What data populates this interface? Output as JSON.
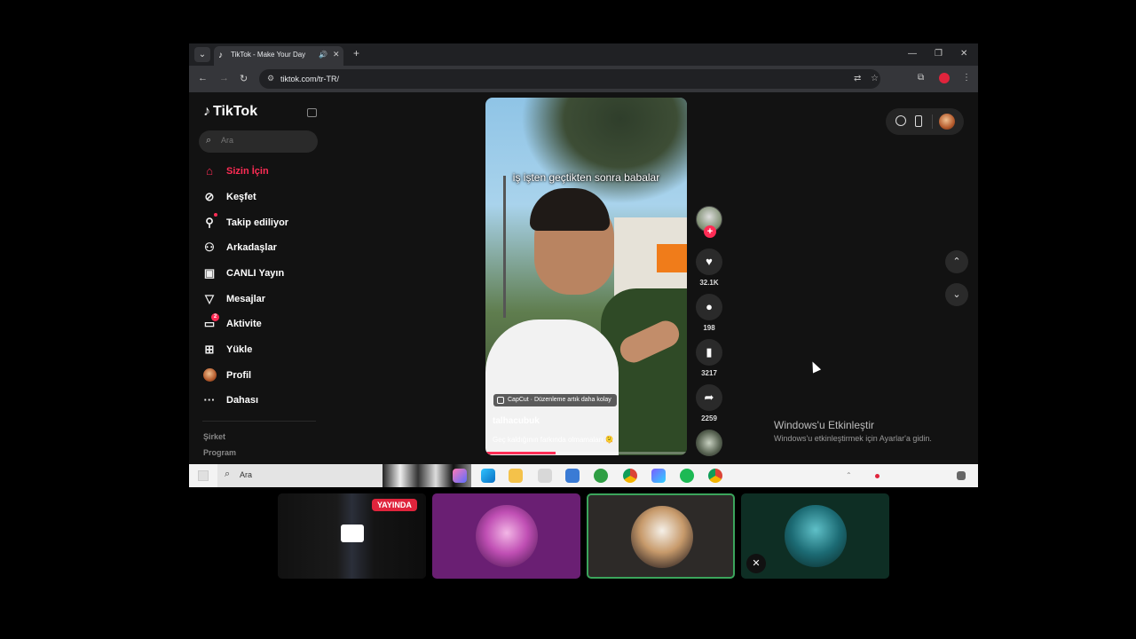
{
  "browser": {
    "tab_title": "TikTok - Make Your Day",
    "url": "tiktok.com/tr-TR/",
    "icons": {
      "tab_menu": "chevron-down-icon",
      "audio": "speaker-icon",
      "close": "close-icon",
      "new_tab": "plus-icon",
      "minimize": "minimize-icon",
      "restore": "restore-icon",
      "window_close": "close-icon",
      "back": "arrow-left-icon",
      "forward": "arrow-right-icon",
      "reload": "reload-icon",
      "translate": "translate-icon",
      "bookmark": "star-icon",
      "extensions": "puzzle-icon",
      "menu": "kebab-icon"
    }
  },
  "tiktok": {
    "logo": "TikTok",
    "search_placeholder": "Ara",
    "nav": [
      {
        "label": "Sizin İçin",
        "icon": "home-icon",
        "active": true
      },
      {
        "label": "Keşfet",
        "icon": "compass-icon"
      },
      {
        "label": "Takip ediliyor",
        "icon": "following-icon"
      },
      {
        "label": "Arkadaşlar",
        "icon": "friends-icon"
      },
      {
        "label": "CANLI Yayın",
        "icon": "live-tv-icon"
      },
      {
        "label": "Mesajlar",
        "icon": "send-icon"
      },
      {
        "label": "Aktivite",
        "icon": "activity-icon",
        "badge": "2"
      },
      {
        "label": "Yükle",
        "icon": "upload-icon"
      },
      {
        "label": "Profil",
        "icon": "profile-avatar"
      },
      {
        "label": "Dahası",
        "icon": "more-icon"
      }
    ],
    "footer": [
      "Şirket",
      "Program"
    ],
    "accent_color": "#fe2c55"
  },
  "video": {
    "caption": "iş işten geçtikten sonra babalar",
    "capcut": "CapCut · Düzenleme artık daha kolay",
    "author": "talhacubuk",
    "description": "Geç kaldığının farkında olmamaları 🫠",
    "progress_fraction": 0.35
  },
  "actions": {
    "likes": "32.1K",
    "comments": "198",
    "saves": "3217",
    "shares": "2259"
  },
  "windows": {
    "activate_title": "Windows'u Etkinleştir",
    "activate_sub": "Windows'u etkinleştirmek için Ayarlar'a gidin."
  },
  "taskbar": {
    "search_placeholder": "Ara",
    "apps": [
      "edge-icon",
      "explorer-icon",
      "store-icon",
      "xbox-icon",
      "chrome-icon",
      "vpn-icon",
      "spotify-icon",
      "chrome-icon"
    ]
  },
  "stream": {
    "live_label": "YAYINDA",
    "tiles": [
      "screen-share",
      "anime-avatar",
      "cat-avatar",
      "fish-avatar"
    ]
  }
}
